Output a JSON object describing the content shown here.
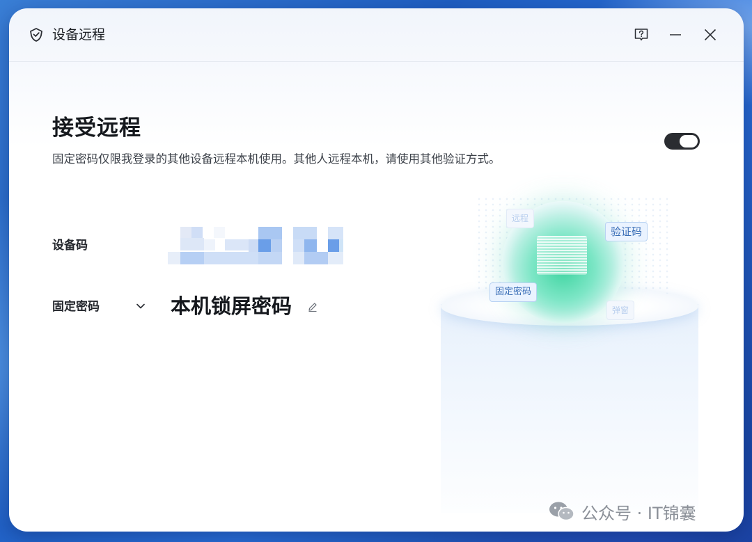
{
  "window": {
    "title": "设备远程",
    "app_icon": "shield-check-icon",
    "controls": {
      "help_icon": "help-bubble-icon",
      "minimize_icon": "minimize-icon",
      "close_icon": "close-icon"
    }
  },
  "section": {
    "title": "接受远程",
    "description": "固定密码仅限我登录的其他设备远程本机使用。其他人远程本机，请使用其他验证方式。",
    "toggle_on": true
  },
  "fields": {
    "device_code_label": "设备码",
    "device_code_value_obscured": true,
    "password_mode_label": "固定密码",
    "password_value": "本机锁屏密码"
  },
  "illustration": {
    "chip_verify": "验证码",
    "chip_fixed": "固定密码",
    "chip_remote": "远程",
    "chip_popup": "弹窗"
  },
  "watermark": {
    "text": "公众号 · IT锦囊",
    "icon": "wechat-icon"
  },
  "colors": {
    "toggle_track": "#2a2c31",
    "chip_text": "#3b6fb7",
    "orb_green": "#3ed4a0"
  }
}
